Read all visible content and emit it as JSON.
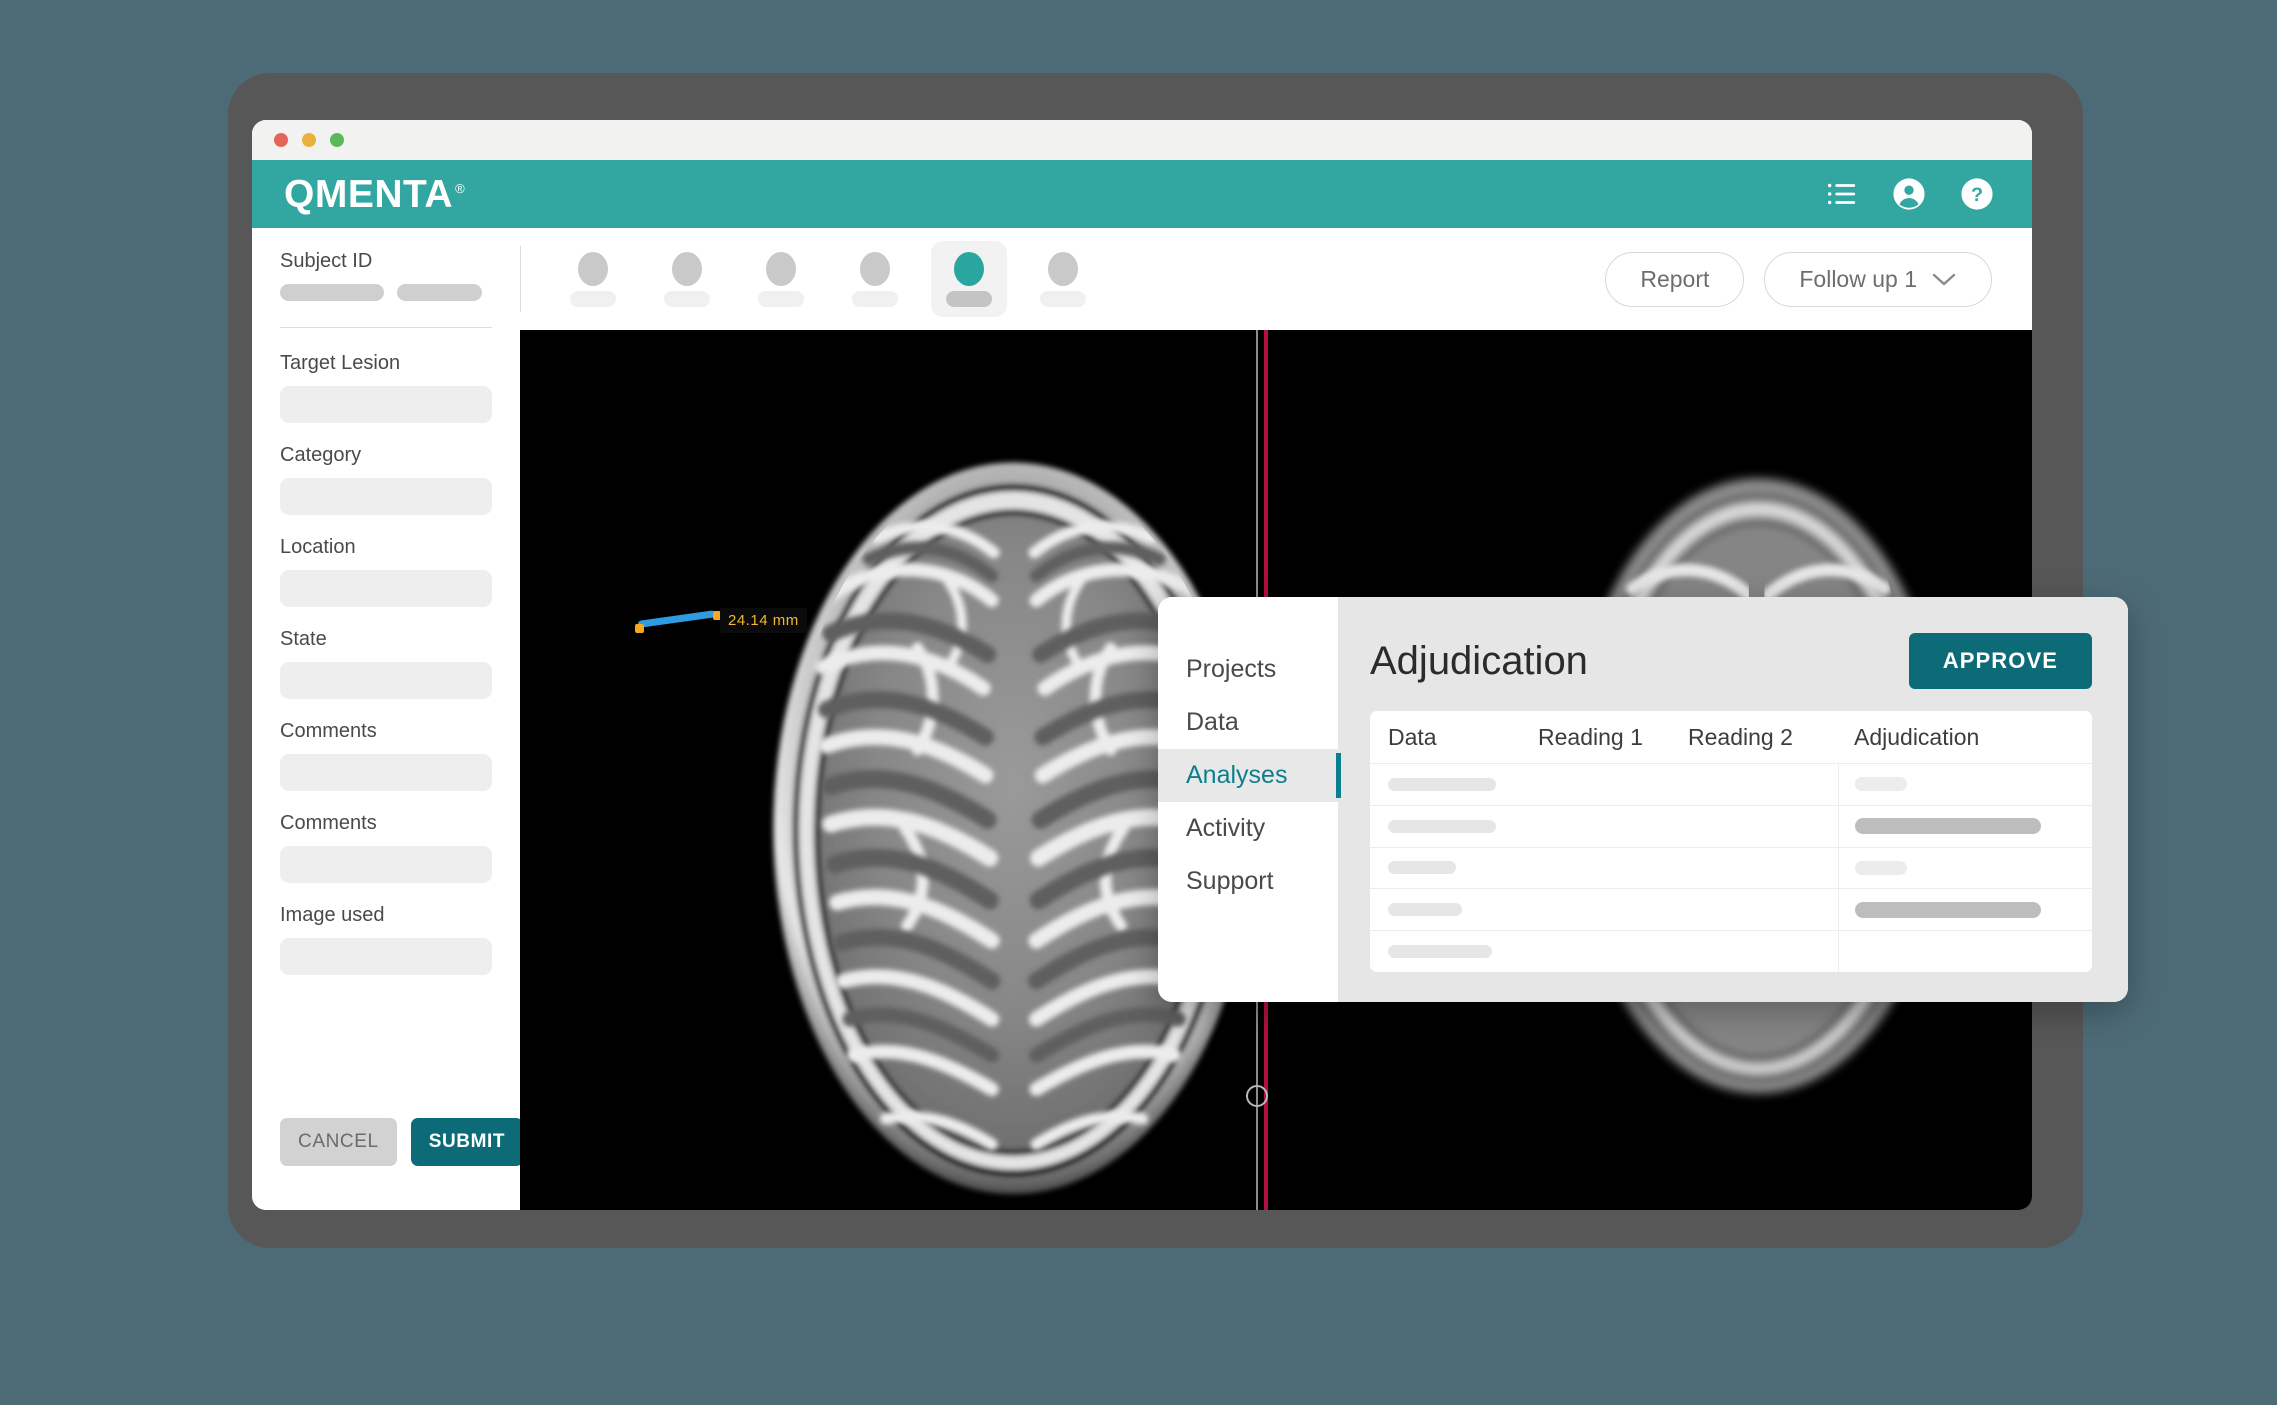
{
  "window": {
    "traffic_lights": [
      "red",
      "yellow",
      "green"
    ]
  },
  "header": {
    "brand": "QMENTA",
    "brand_mark": "®",
    "icons": [
      {
        "name": "list-icon",
        "label": "List"
      },
      {
        "name": "account-circle-icon",
        "label": "Account"
      },
      {
        "name": "help-circle-icon",
        "label": "Help"
      }
    ]
  },
  "sidebar": {
    "subject_label": "Subject ID",
    "fields": [
      {
        "label": "Target Lesion",
        "value": ""
      },
      {
        "label": "Category",
        "value": ""
      },
      {
        "label": "Location",
        "value": ""
      },
      {
        "label": "State",
        "value": ""
      },
      {
        "label": "Comments",
        "value": ""
      },
      {
        "label": "Comments",
        "value": ""
      },
      {
        "label": "Image used",
        "value": ""
      }
    ],
    "cancel_label": "CANCEL",
    "submit_label": "SUBMIT"
  },
  "subject_bar": {
    "avatars": [
      {
        "active": false
      },
      {
        "active": false
      },
      {
        "active": false
      },
      {
        "active": false
      },
      {
        "active": true
      },
      {
        "active": false
      }
    ],
    "report_label": "Report",
    "followup_label": "Follow up 1"
  },
  "viewer": {
    "measurement_value": "24.14 mm",
    "annotation_color": "#f5b72e",
    "line_color": "#2e9ce0",
    "handle_color": "#f5a623",
    "crosshair_color": "#b2103f"
  },
  "modal": {
    "nav": [
      {
        "label": "Projects",
        "active": false
      },
      {
        "label": "Data",
        "active": false
      },
      {
        "label": "Analyses",
        "active": true
      },
      {
        "label": "Activity",
        "active": false
      },
      {
        "label": "Support",
        "active": false
      }
    ],
    "title": "Adjudication",
    "approve_label": "APPROVE",
    "table": {
      "columns": [
        "Data",
        "Reading 1",
        "Reading 2",
        "Adjudication"
      ],
      "rows": [
        {
          "data_width": 108,
          "reading1": "dot",
          "reading2": "dot",
          "adjudication": "small"
        },
        {
          "data_width": 108,
          "reading1": "dot",
          "reading2": "dot",
          "adjudication": "big"
        },
        {
          "data_width": 68,
          "reading1": "dot",
          "reading2": "dot",
          "adjudication": "small"
        },
        {
          "data_width": 74,
          "reading1": "dot",
          "reading2": "dot",
          "adjudication": "big"
        },
        {
          "data_width": 104,
          "reading1": "dot",
          "reading2": "dot",
          "adjudication": "none"
        }
      ]
    }
  },
  "colors": {
    "page_background": "#4d6b77",
    "bezel": "#575757",
    "brand_teal": "#32a6a0",
    "action_teal": "#0d6b78",
    "accent_teal": "#0d7f8c"
  }
}
